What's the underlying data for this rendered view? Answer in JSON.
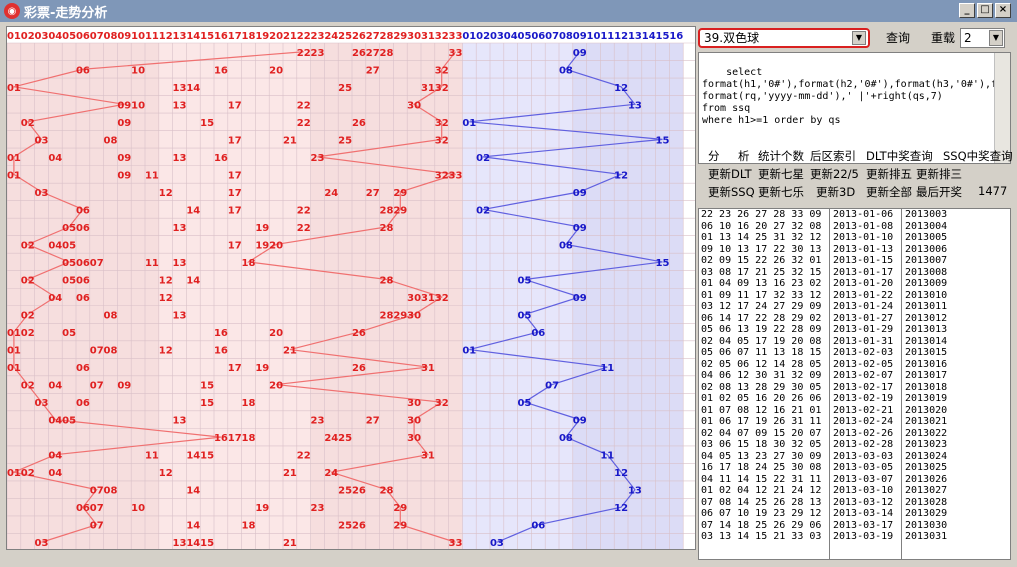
{
  "window": {
    "title": "彩票-走势分析"
  },
  "chart": {
    "red_header": [
      "01",
      "02",
      "03",
      "04",
      "05",
      "06",
      "07",
      "08",
      "09",
      "10",
      "11",
      "12",
      "13",
      "14",
      "15",
      "16",
      "17",
      "18",
      "19",
      "20",
      "21",
      "22",
      "23",
      "24",
      "25",
      "26",
      "27",
      "28",
      "29",
      "30",
      "31",
      "32",
      "33"
    ],
    "blue_header": [
      "01",
      "02",
      "03",
      "04",
      "05",
      "06",
      "07",
      "08",
      "09",
      "10",
      "11",
      "12",
      "13",
      "14",
      "15",
      "16"
    ],
    "colors": {
      "red": "#e02020",
      "blue": "#1818c8",
      "red_line": "#f07070",
      "blue_line": "#6060e0"
    }
  },
  "controls": {
    "lottery_select": "39.双色球",
    "query_button": "查询",
    "reload_button": "重载",
    "count_select": "2"
  },
  "sql_text": "select\nformat(h1,'0#'),format(h2,'0#'),format(h3,'0#'),f\nformat(rq,'yyyy-mm-dd'),' |'+right(qs,7)\nfrom ssq\nwhere h1>=1 order by qs",
  "tools": {
    "row1": [
      "分",
      "析",
      "统计个数",
      "后区索引",
      "DLT中奖查询",
      "SSQ中奖查询"
    ],
    "row2": [
      "更新DLT",
      "更新七星",
      "更新22/5",
      "更新排五",
      "更新排三"
    ],
    "row3": [
      "更新SSQ",
      "更新七乐",
      "更新3D",
      "更新全部",
      "最后开奖",
      "1477"
    ]
  },
  "results": [
    {
      "nums": "22 23 26 27 28 33 09",
      "date": "2013-01-06",
      "issue": "2013003"
    },
    {
      "nums": "06 10 16 20 27 32 08",
      "date": "2013-01-08",
      "issue": "2013004"
    },
    {
      "nums": "01 13 14 25 31 32 12",
      "date": "2013-01-10",
      "issue": "2013005"
    },
    {
      "nums": "09 10 13 17 22 30 13",
      "date": "2013-01-13",
      "issue": "2013006"
    },
    {
      "nums": "02 09 15 22 26 32 01",
      "date": "2013-01-15",
      "issue": "2013007"
    },
    {
      "nums": "03 08 17 21 25 32 15",
      "date": "2013-01-17",
      "issue": "2013008"
    },
    {
      "nums": "01 04 09 13 16 23 02",
      "date": "2013-01-20",
      "issue": "2013009"
    },
    {
      "nums": "01 09 11 17 32 33 12",
      "date": "2013-01-22",
      "issue": "2013010"
    },
    {
      "nums": "03 12 17 24 27 29 09",
      "date": "2013-01-24",
      "issue": "2013011"
    },
    {
      "nums": "06 14 17 22 28 29 02",
      "date": "2013-01-27",
      "issue": "2013012"
    },
    {
      "nums": "05 06 13 19 22 28 09",
      "date": "2013-01-29",
      "issue": "2013013"
    },
    {
      "nums": "02 04 05 17 19 20 08",
      "date": "2013-01-31",
      "issue": "2013014"
    },
    {
      "nums": "05 06 07 11 13 18 15",
      "date": "2013-02-03",
      "issue": "2013015"
    },
    {
      "nums": "02 05 06 12 14 28 05",
      "date": "2013-02-05",
      "issue": "2013016"
    },
    {
      "nums": "04 06 12 30 31 32 09",
      "date": "2013-02-07",
      "issue": "2013017"
    },
    {
      "nums": "02 08 13 28 29 30 05",
      "date": "2013-02-17",
      "issue": "2013018"
    },
    {
      "nums": "01 02 05 16 20 26 06",
      "date": "2013-02-19",
      "issue": "2013019"
    },
    {
      "nums": "01 07 08 12 16 21 01",
      "date": "2013-02-21",
      "issue": "2013020"
    },
    {
      "nums": "01 06 17 19 26 31 11",
      "date": "2013-02-24",
      "issue": "2013021"
    },
    {
      "nums": "02 04 07 09 15 20 07",
      "date": "2013-02-26",
      "issue": "2013022"
    },
    {
      "nums": "03 06 15 18 30 32 05",
      "date": "2013-02-28",
      "issue": "2013023"
    },
    {
      "nums": "04 05 13 23 27 30 09",
      "date": "2013-03-03",
      "issue": "2013024"
    },
    {
      "nums": "16 17 18 24 25 30 08",
      "date": "2013-03-05",
      "issue": "2013025"
    },
    {
      "nums": "04 11 14 15 22 31 11",
      "date": "2013-03-07",
      "issue": "2013026"
    },
    {
      "nums": "01 02 04 12 21 24 12",
      "date": "2013-03-10",
      "issue": "2013027"
    },
    {
      "nums": "07 08 14 25 26 28 13",
      "date": "2013-03-12",
      "issue": "2013028"
    },
    {
      "nums": "06 07 10 19 23 29 12",
      "date": "2013-03-14",
      "issue": "2013029"
    },
    {
      "nums": "07 14 18 25 26 29 06",
      "date": "2013-03-17",
      "issue": "2013030"
    },
    {
      "nums": "03 13 14 15 21 33 03",
      "date": "2013-03-19",
      "issue": "2013031"
    }
  ]
}
